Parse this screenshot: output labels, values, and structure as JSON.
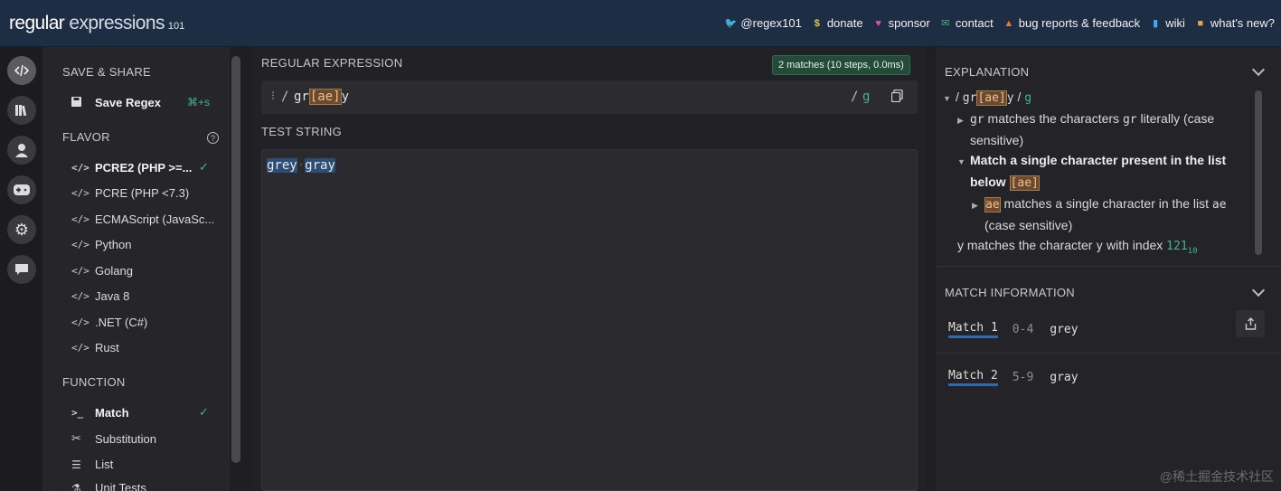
{
  "header": {
    "logo_main": "regular",
    "logo_exp": " expressions",
    "logo_ver": "101",
    "nav": [
      {
        "icon": "twitter-icon",
        "label": "@regex101",
        "color": "#4aa3ef"
      },
      {
        "icon": "dollar-icon",
        "label": "donate",
        "color": "#e4c44a"
      },
      {
        "icon": "heart-icon",
        "label": "sponsor",
        "color": "#e0559a"
      },
      {
        "icon": "mail-icon",
        "label": "contact",
        "color": "#46b47a"
      },
      {
        "icon": "warning-icon",
        "label": "bug reports & feedback",
        "color": "#e07a3a"
      },
      {
        "icon": "book-icon",
        "label": "wiki",
        "color": "#4aa3ef"
      },
      {
        "icon": "gift-icon",
        "label": "what's new?",
        "color": "#e4a444"
      }
    ]
  },
  "rail": [
    "code-icon",
    "library-icon",
    "user-icon",
    "gamepad-icon",
    "gear-icon",
    "chat-icon"
  ],
  "left": {
    "save_title": "SAVE & SHARE",
    "save_label": "Save Regex",
    "save_shortcut": "⌘+s",
    "flavor_title": "FLAVOR",
    "flavors": [
      "PCRE2 (PHP >=...",
      "PCRE (PHP <7.3)",
      "ECMAScript (JavaSc...",
      "Python",
      "Golang",
      "Java 8",
      ".NET (C#)",
      "Rust"
    ],
    "function_title": "FUNCTION",
    "functions": [
      "Match",
      "Substitution",
      "List",
      "Unit Tests"
    ]
  },
  "regex": {
    "label": "REGULAR EXPRESSION",
    "delimiter": "/",
    "pattern_prefix": "gr",
    "pattern_class": "[ae]",
    "pattern_suffix": "y",
    "flags": "g",
    "badge": "2 matches (10 steps, 0.0ms)"
  },
  "test": {
    "label": "TEST STRING",
    "word1": "grey",
    "word2": "gray"
  },
  "explanation": {
    "title": "EXPLANATION",
    "line1_slash": "/",
    "line1_prefix": "gr",
    "line1_class": "[ae]",
    "line1_suffix": "y",
    "line1_flag": "g",
    "gr_code": "gr",
    "gr_text": "matches the characters",
    "gr_code2": "gr",
    "gr_text2": "literally (case",
    "gr_text3": "sensitive)",
    "set_title": "Match a single character present in the list",
    "set_title2": "below",
    "set_class": "[ae]",
    "ae_code": "ae",
    "ae_text": "matches a single character in the list",
    "ae_code2": "ae",
    "ae_text2": "(case sensitive)",
    "y_text": "y matches the character",
    "y_code": "y",
    "y_text2": "with index",
    "y_index": "121",
    "y_sub": "10"
  },
  "match_info": {
    "title": "MATCH INFORMATION",
    "matches": [
      {
        "name": "Match 1",
        "range": "0-4",
        "value": "grey"
      },
      {
        "name": "Match 2",
        "range": "5-9",
        "value": "gray"
      }
    ]
  },
  "watermark": "@稀土掘金技术社区"
}
